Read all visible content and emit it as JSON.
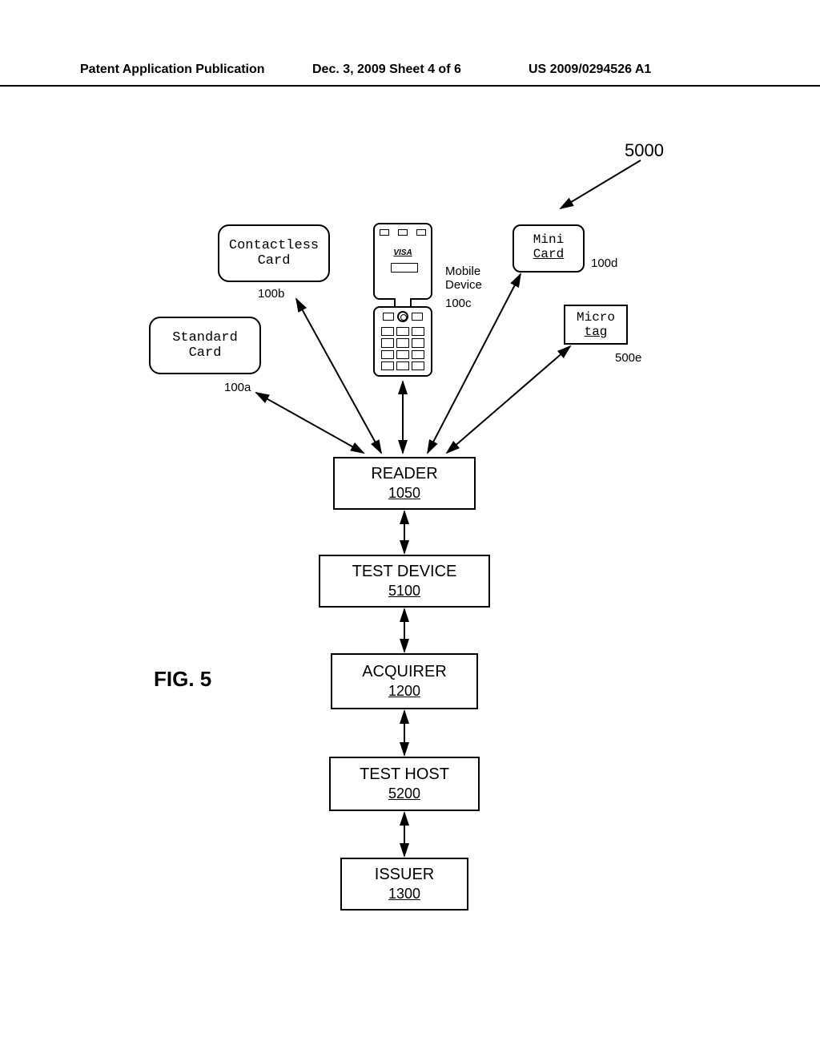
{
  "header": {
    "left": "Patent Application Publication",
    "mid": "Dec. 3, 2009   Sheet 4 of 6",
    "right": "US 2009/0294526 A1"
  },
  "figure_ref": "5000",
  "figure_label": "FIG. 5",
  "devices": {
    "standard": {
      "label": "Standard\nCard",
      "ref": "100a"
    },
    "contactless": {
      "label": "Contactless\nCard",
      "ref": "100b"
    },
    "mobile": {
      "side_label": "Mobile\nDevice",
      "ref": "100c",
      "visa": "VISA"
    },
    "mini": {
      "line1": "Mini",
      "line2": "Card",
      "ref": "100d"
    },
    "micro": {
      "line1": "Micro",
      "line2": "tag",
      "ref": "500e"
    }
  },
  "blocks": {
    "reader": {
      "title": "READER",
      "ref": "1050"
    },
    "testdev": {
      "title": "TEST DEVICE",
      "ref": "5100"
    },
    "acquirer": {
      "title": "ACQUIRER",
      "ref": "1200"
    },
    "testhost": {
      "title": "TEST HOST",
      "ref": "5200"
    },
    "issuer": {
      "title": "ISSUER",
      "ref": "1300"
    }
  }
}
